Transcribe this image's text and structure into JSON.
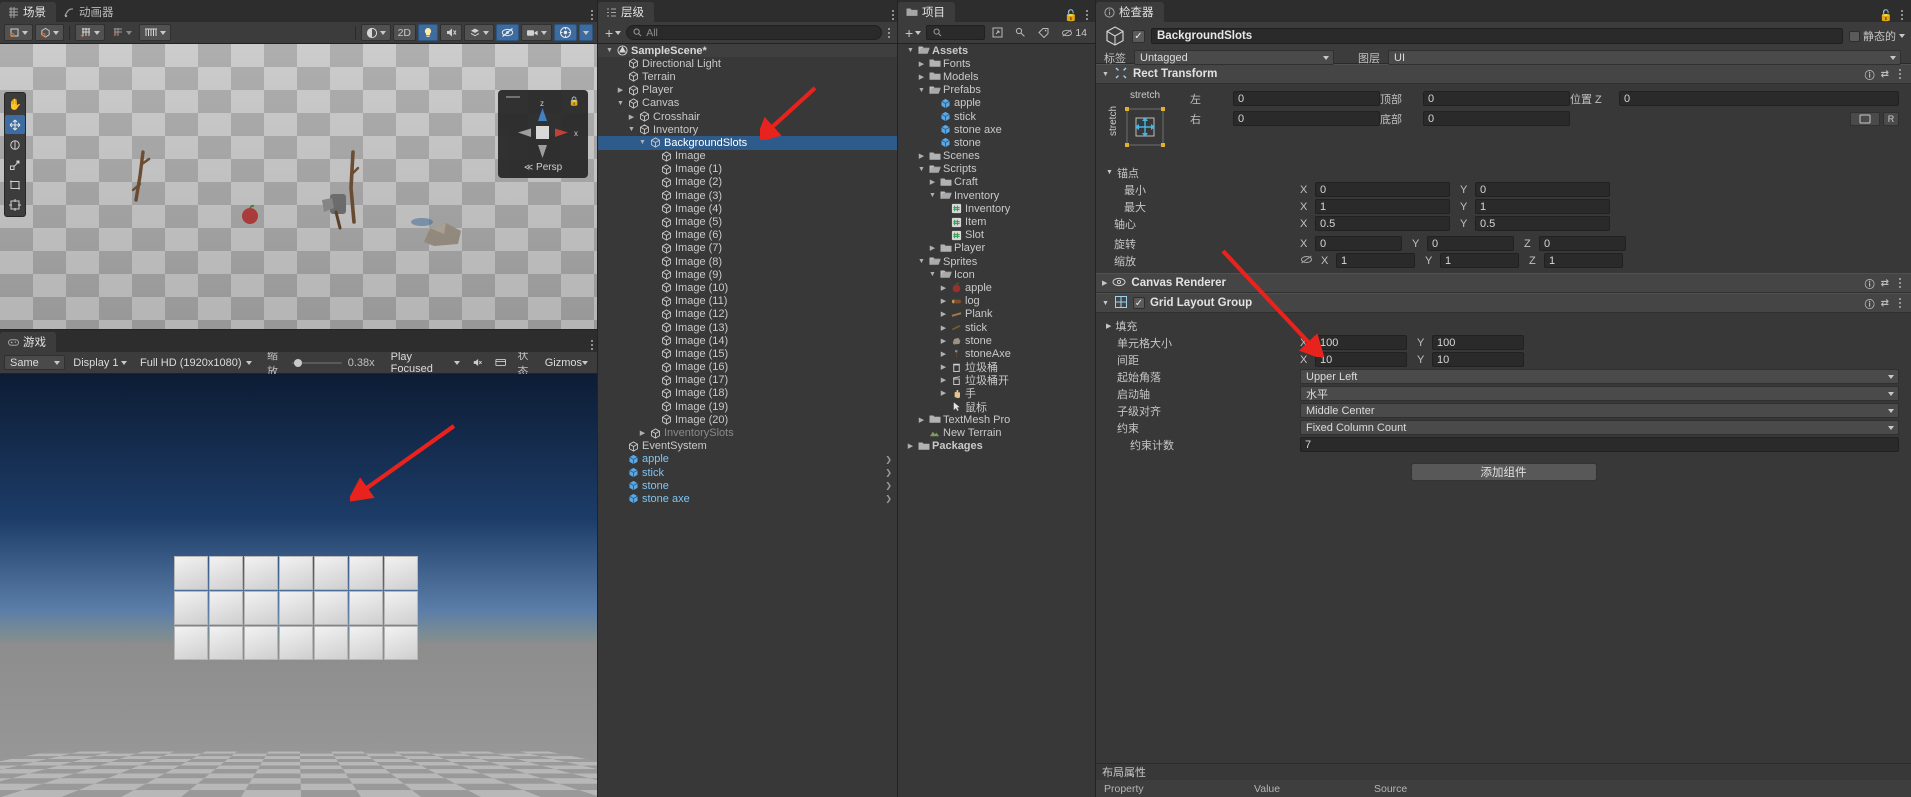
{
  "scene": {
    "tabs": [
      {
        "label": "场景",
        "icon": "scene-icon",
        "active": true
      },
      {
        "label": "动画器",
        "icon": "animator-icon",
        "active": false
      }
    ],
    "toolbar": {
      "pivot_label": "pivot-toggle",
      "shading_label": "shading-mode",
      "twod_label": "2D",
      "light_label": "lighting-toggle",
      "audio_label": "audio-toggle",
      "fx_label": "effects-toggle",
      "vis_label": "visibility-toggle",
      "camera_label": "scene-camera",
      "gizmos_label": "gizmos-toggle"
    },
    "gizmo": {
      "axis_z": "z",
      "axis_x": "x",
      "persp": "Persp"
    },
    "left_tools": [
      "hand-tool",
      "move-tool",
      "rotate-tool",
      "scale-tool",
      "rect-tool",
      "transform-tool"
    ]
  },
  "game": {
    "tabs": [
      {
        "label": "游戏",
        "icon": "game-icon",
        "active": true
      }
    ],
    "toolbar": {
      "aspect": "Same",
      "display": "Display 1",
      "resolution": "Full HD (1920x1080)",
      "scale_label": "缩放",
      "scale_value": "0.38x",
      "play_focused": "Play Focused",
      "mute_label": "mute-audio",
      "stats_label": "状态",
      "gizmos_label": "Gizmos"
    },
    "slot_rows": 3,
    "slot_cols": 7
  },
  "hierarchy": {
    "tab": {
      "label": "层级",
      "icon": "hierarchy-icon"
    },
    "toolbar": {
      "add_label": "+",
      "search_placeholder": "All"
    },
    "items": [
      {
        "label": "SampleScene*",
        "depth": 0,
        "twisty": "down",
        "icon": "unity-scene",
        "style": "scene"
      },
      {
        "label": "Directional Light",
        "depth": 1,
        "twisty": "",
        "icon": "gameobject"
      },
      {
        "label": "Terrain",
        "depth": 1,
        "twisty": "",
        "icon": "gameobject"
      },
      {
        "label": "Player",
        "depth": 1,
        "twisty": "right",
        "icon": "gameobject"
      },
      {
        "label": "Canvas",
        "depth": 1,
        "twisty": "down",
        "icon": "gameobject"
      },
      {
        "label": "Crosshair",
        "depth": 2,
        "twisty": "right",
        "icon": "gameobject"
      },
      {
        "label": "Inventory",
        "depth": 2,
        "twisty": "down",
        "icon": "gameobject"
      },
      {
        "label": "BackgroundSlots",
        "depth": 3,
        "twisty": "down",
        "icon": "gameobject",
        "style": "sel"
      },
      {
        "label": "Image",
        "depth": 4,
        "twisty": "",
        "icon": "gameobject"
      },
      {
        "label": "Image (1)",
        "depth": 4,
        "twisty": "",
        "icon": "gameobject"
      },
      {
        "label": "Image (2)",
        "depth": 4,
        "twisty": "",
        "icon": "gameobject"
      },
      {
        "label": "Image (3)",
        "depth": 4,
        "twisty": "",
        "icon": "gameobject"
      },
      {
        "label": "Image (4)",
        "depth": 4,
        "twisty": "",
        "icon": "gameobject"
      },
      {
        "label": "Image (5)",
        "depth": 4,
        "twisty": "",
        "icon": "gameobject"
      },
      {
        "label": "Image (6)",
        "depth": 4,
        "twisty": "",
        "icon": "gameobject"
      },
      {
        "label": "Image (7)",
        "depth": 4,
        "twisty": "",
        "icon": "gameobject"
      },
      {
        "label": "Image (8)",
        "depth": 4,
        "twisty": "",
        "icon": "gameobject"
      },
      {
        "label": "Image (9)",
        "depth": 4,
        "twisty": "",
        "icon": "gameobject"
      },
      {
        "label": "Image (10)",
        "depth": 4,
        "twisty": "",
        "icon": "gameobject"
      },
      {
        "label": "Image (11)",
        "depth": 4,
        "twisty": "",
        "icon": "gameobject"
      },
      {
        "label": "Image (12)",
        "depth": 4,
        "twisty": "",
        "icon": "gameobject"
      },
      {
        "label": "Image (13)",
        "depth": 4,
        "twisty": "",
        "icon": "gameobject"
      },
      {
        "label": "Image (14)",
        "depth": 4,
        "twisty": "",
        "icon": "gameobject"
      },
      {
        "label": "Image (15)",
        "depth": 4,
        "twisty": "",
        "icon": "gameobject"
      },
      {
        "label": "Image (16)",
        "depth": 4,
        "twisty": "",
        "icon": "gameobject"
      },
      {
        "label": "Image (17)",
        "depth": 4,
        "twisty": "",
        "icon": "gameobject"
      },
      {
        "label": "Image (18)",
        "depth": 4,
        "twisty": "",
        "icon": "gameobject"
      },
      {
        "label": "Image (19)",
        "depth": 4,
        "twisty": "",
        "icon": "gameobject"
      },
      {
        "label": "Image (20)",
        "depth": 4,
        "twisty": "",
        "icon": "gameobject"
      },
      {
        "label": "InventorySlots",
        "depth": 3,
        "twisty": "right",
        "icon": "gameobject",
        "style": "dim"
      },
      {
        "label": "EventSystem",
        "depth": 1,
        "twisty": "",
        "icon": "gameobject"
      },
      {
        "label": "apple",
        "depth": 1,
        "twisty": "",
        "icon": "prefab",
        "style": "prefab",
        "expand": true
      },
      {
        "label": "stick",
        "depth": 1,
        "twisty": "",
        "icon": "prefab",
        "style": "prefab",
        "expand": true
      },
      {
        "label": "stone",
        "depth": 1,
        "twisty": "",
        "icon": "prefab",
        "style": "prefab",
        "expand": true
      },
      {
        "label": "stone axe",
        "depth": 1,
        "twisty": "",
        "icon": "prefab",
        "style": "prefab",
        "expand": true
      }
    ]
  },
  "project": {
    "tab": {
      "label": "项目",
      "icon": "project-icon"
    },
    "toolbar": {
      "add_label": "+",
      "search_placeholder": "",
      "count": "14"
    },
    "items": [
      {
        "label": "Assets",
        "depth": 0,
        "twisty": "down",
        "icon": "folder-open",
        "bold": true
      },
      {
        "label": "Fonts",
        "depth": 1,
        "twisty": "right",
        "icon": "folder"
      },
      {
        "label": "Models",
        "depth": 1,
        "twisty": "right",
        "icon": "folder"
      },
      {
        "label": "Prefabs",
        "depth": 1,
        "twisty": "down",
        "icon": "folder-open"
      },
      {
        "label": "apple",
        "depth": 2,
        "twisty": "",
        "icon": "prefab"
      },
      {
        "label": "stick",
        "depth": 2,
        "twisty": "",
        "icon": "prefab"
      },
      {
        "label": "stone axe",
        "depth": 2,
        "twisty": "",
        "icon": "prefab"
      },
      {
        "label": "stone",
        "depth": 2,
        "twisty": "",
        "icon": "prefab"
      },
      {
        "label": "Scenes",
        "depth": 1,
        "twisty": "right",
        "icon": "folder"
      },
      {
        "label": "Scripts",
        "depth": 1,
        "twisty": "down",
        "icon": "folder-open"
      },
      {
        "label": "Craft",
        "depth": 2,
        "twisty": "right",
        "icon": "folder"
      },
      {
        "label": "Inventory",
        "depth": 2,
        "twisty": "down",
        "icon": "folder-open"
      },
      {
        "label": "Inventory",
        "depth": 3,
        "twisty": "",
        "icon": "script"
      },
      {
        "label": "Item",
        "depth": 3,
        "twisty": "",
        "icon": "script"
      },
      {
        "label": "Slot",
        "depth": 3,
        "twisty": "",
        "icon": "script"
      },
      {
        "label": "Player",
        "depth": 2,
        "twisty": "right",
        "icon": "folder"
      },
      {
        "label": "Sprites",
        "depth": 1,
        "twisty": "down",
        "icon": "folder-open"
      },
      {
        "label": "Icon",
        "depth": 2,
        "twisty": "down",
        "icon": "folder-open"
      },
      {
        "label": "apple",
        "depth": 3,
        "twisty": "right",
        "icon": "sprite-apple"
      },
      {
        "label": "log",
        "depth": 3,
        "twisty": "right",
        "icon": "sprite-log"
      },
      {
        "label": "Plank",
        "depth": 3,
        "twisty": "right",
        "icon": "sprite-plank"
      },
      {
        "label": "stick",
        "depth": 3,
        "twisty": "right",
        "icon": "sprite-stick"
      },
      {
        "label": "stone",
        "depth": 3,
        "twisty": "right",
        "icon": "sprite-stone"
      },
      {
        "label": "stoneAxe",
        "depth": 3,
        "twisty": "right",
        "icon": "sprite-stoneaxe"
      },
      {
        "label": "垃圾桶",
        "depth": 3,
        "twisty": "right",
        "icon": "sprite-bin"
      },
      {
        "label": "垃圾桶开",
        "depth": 3,
        "twisty": "right",
        "icon": "sprite-bin-open"
      },
      {
        "label": "手",
        "depth": 3,
        "twisty": "right",
        "icon": "sprite-hand"
      },
      {
        "label": "鼠标",
        "depth": 3,
        "twisty": "",
        "icon": "sprite-mouse"
      },
      {
        "label": "TextMesh Pro",
        "depth": 1,
        "twisty": "right",
        "icon": "folder"
      },
      {
        "label": "New Terrain",
        "depth": 1,
        "twisty": "",
        "icon": "terrain"
      },
      {
        "label": "Packages",
        "depth": 0,
        "twisty": "right",
        "icon": "folder",
        "bold": true
      }
    ]
  },
  "inspector": {
    "tab": {
      "label": "检查器",
      "icon": "inspector-icon"
    },
    "object_name": "BackgroundSlots",
    "enabled": true,
    "static_label": "静态的",
    "tag_label": "标签",
    "tag_value": "Untagged",
    "layer_label": "图层",
    "layer_value": "UI",
    "rect_transform": {
      "title": "Rect Transform",
      "anchor_preset": "stretch",
      "anchor_preset_v": "stretch",
      "left_label": "左",
      "left_value": "0",
      "top_label": "顶部",
      "top_value": "0",
      "posz_label": "位置 Z",
      "posz_value": "0",
      "right_label": "右",
      "right_value": "0",
      "bottom_label": "底部",
      "bottom_value": "0",
      "blueprint_label": "R",
      "anchors_label": "锚点",
      "min_label": "最小",
      "min_x": "0",
      "min_y": "0",
      "max_label": "最大",
      "max_x": "1",
      "max_y": "1",
      "pivot_label": "轴心",
      "pivot_x": "0.5",
      "pivot_y": "0.5",
      "rotation_label": "旋转",
      "rot_x": "0",
      "rot_y": "0",
      "rot_z": "0",
      "scale_label": "缩放",
      "scale_x": "1",
      "scale_y": "1",
      "scale_z": "1"
    },
    "canvas_renderer": {
      "title": "Canvas Renderer"
    },
    "grid_layout": {
      "title": "Grid Layout Group",
      "enabled": true,
      "padding_label": "填充",
      "cell_size_label": "单元格大小",
      "cell_x": "100",
      "cell_y": "100",
      "spacing_label": "间距",
      "spacing_x": "10",
      "spacing_y": "10",
      "start_corner_label": "起始角落",
      "start_corner_value": "Upper Left",
      "start_axis_label": "启动轴",
      "start_axis_value": "水平",
      "child_align_label": "子级对齐",
      "child_align_value": "Middle Center",
      "constraint_label": "约束",
      "constraint_value": "Fixed Column Count",
      "constraint_count_label": "约束计数",
      "constraint_count_value": "7"
    },
    "add_component_label": "添加组件",
    "footer": {
      "title": "布局属性",
      "col_property": "Property",
      "col_value": "Value",
      "col_source": "Source"
    }
  },
  "annotations": {
    "arrow_color": "#e8221c",
    "arrows": [
      {
        "name": "arrow-to-backgroundslots"
      },
      {
        "name": "arrow-to-start-corner"
      },
      {
        "name": "arrow-to-slot-grid"
      }
    ]
  }
}
